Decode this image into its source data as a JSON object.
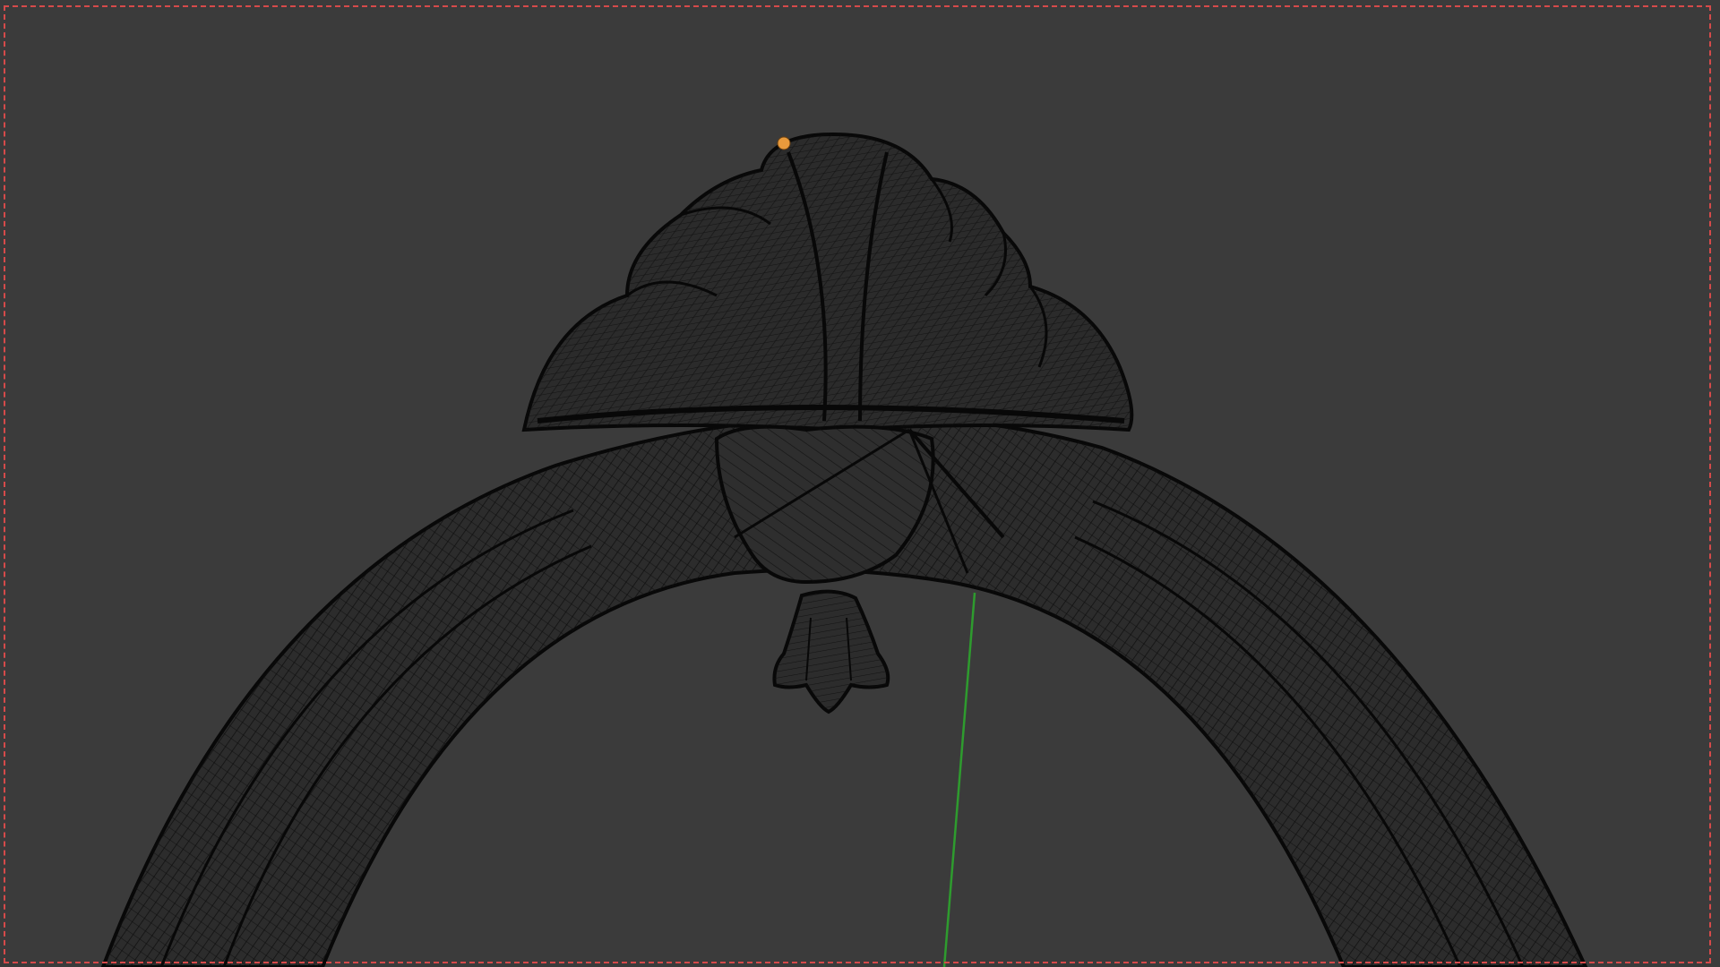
{
  "app": {
    "view": "3D Viewport",
    "shading": "wireframe"
  },
  "colors": {
    "background": "#3b3b3b",
    "frame_border": "#d64a4a",
    "wire": "#0d0d0d",
    "axis_y": "#2e9b2e",
    "origin": "#e89a3c"
  },
  "scene": {
    "object": "ring-mesh",
    "icons": [
      "origin-point-icon",
      "y-axis-line"
    ]
  }
}
